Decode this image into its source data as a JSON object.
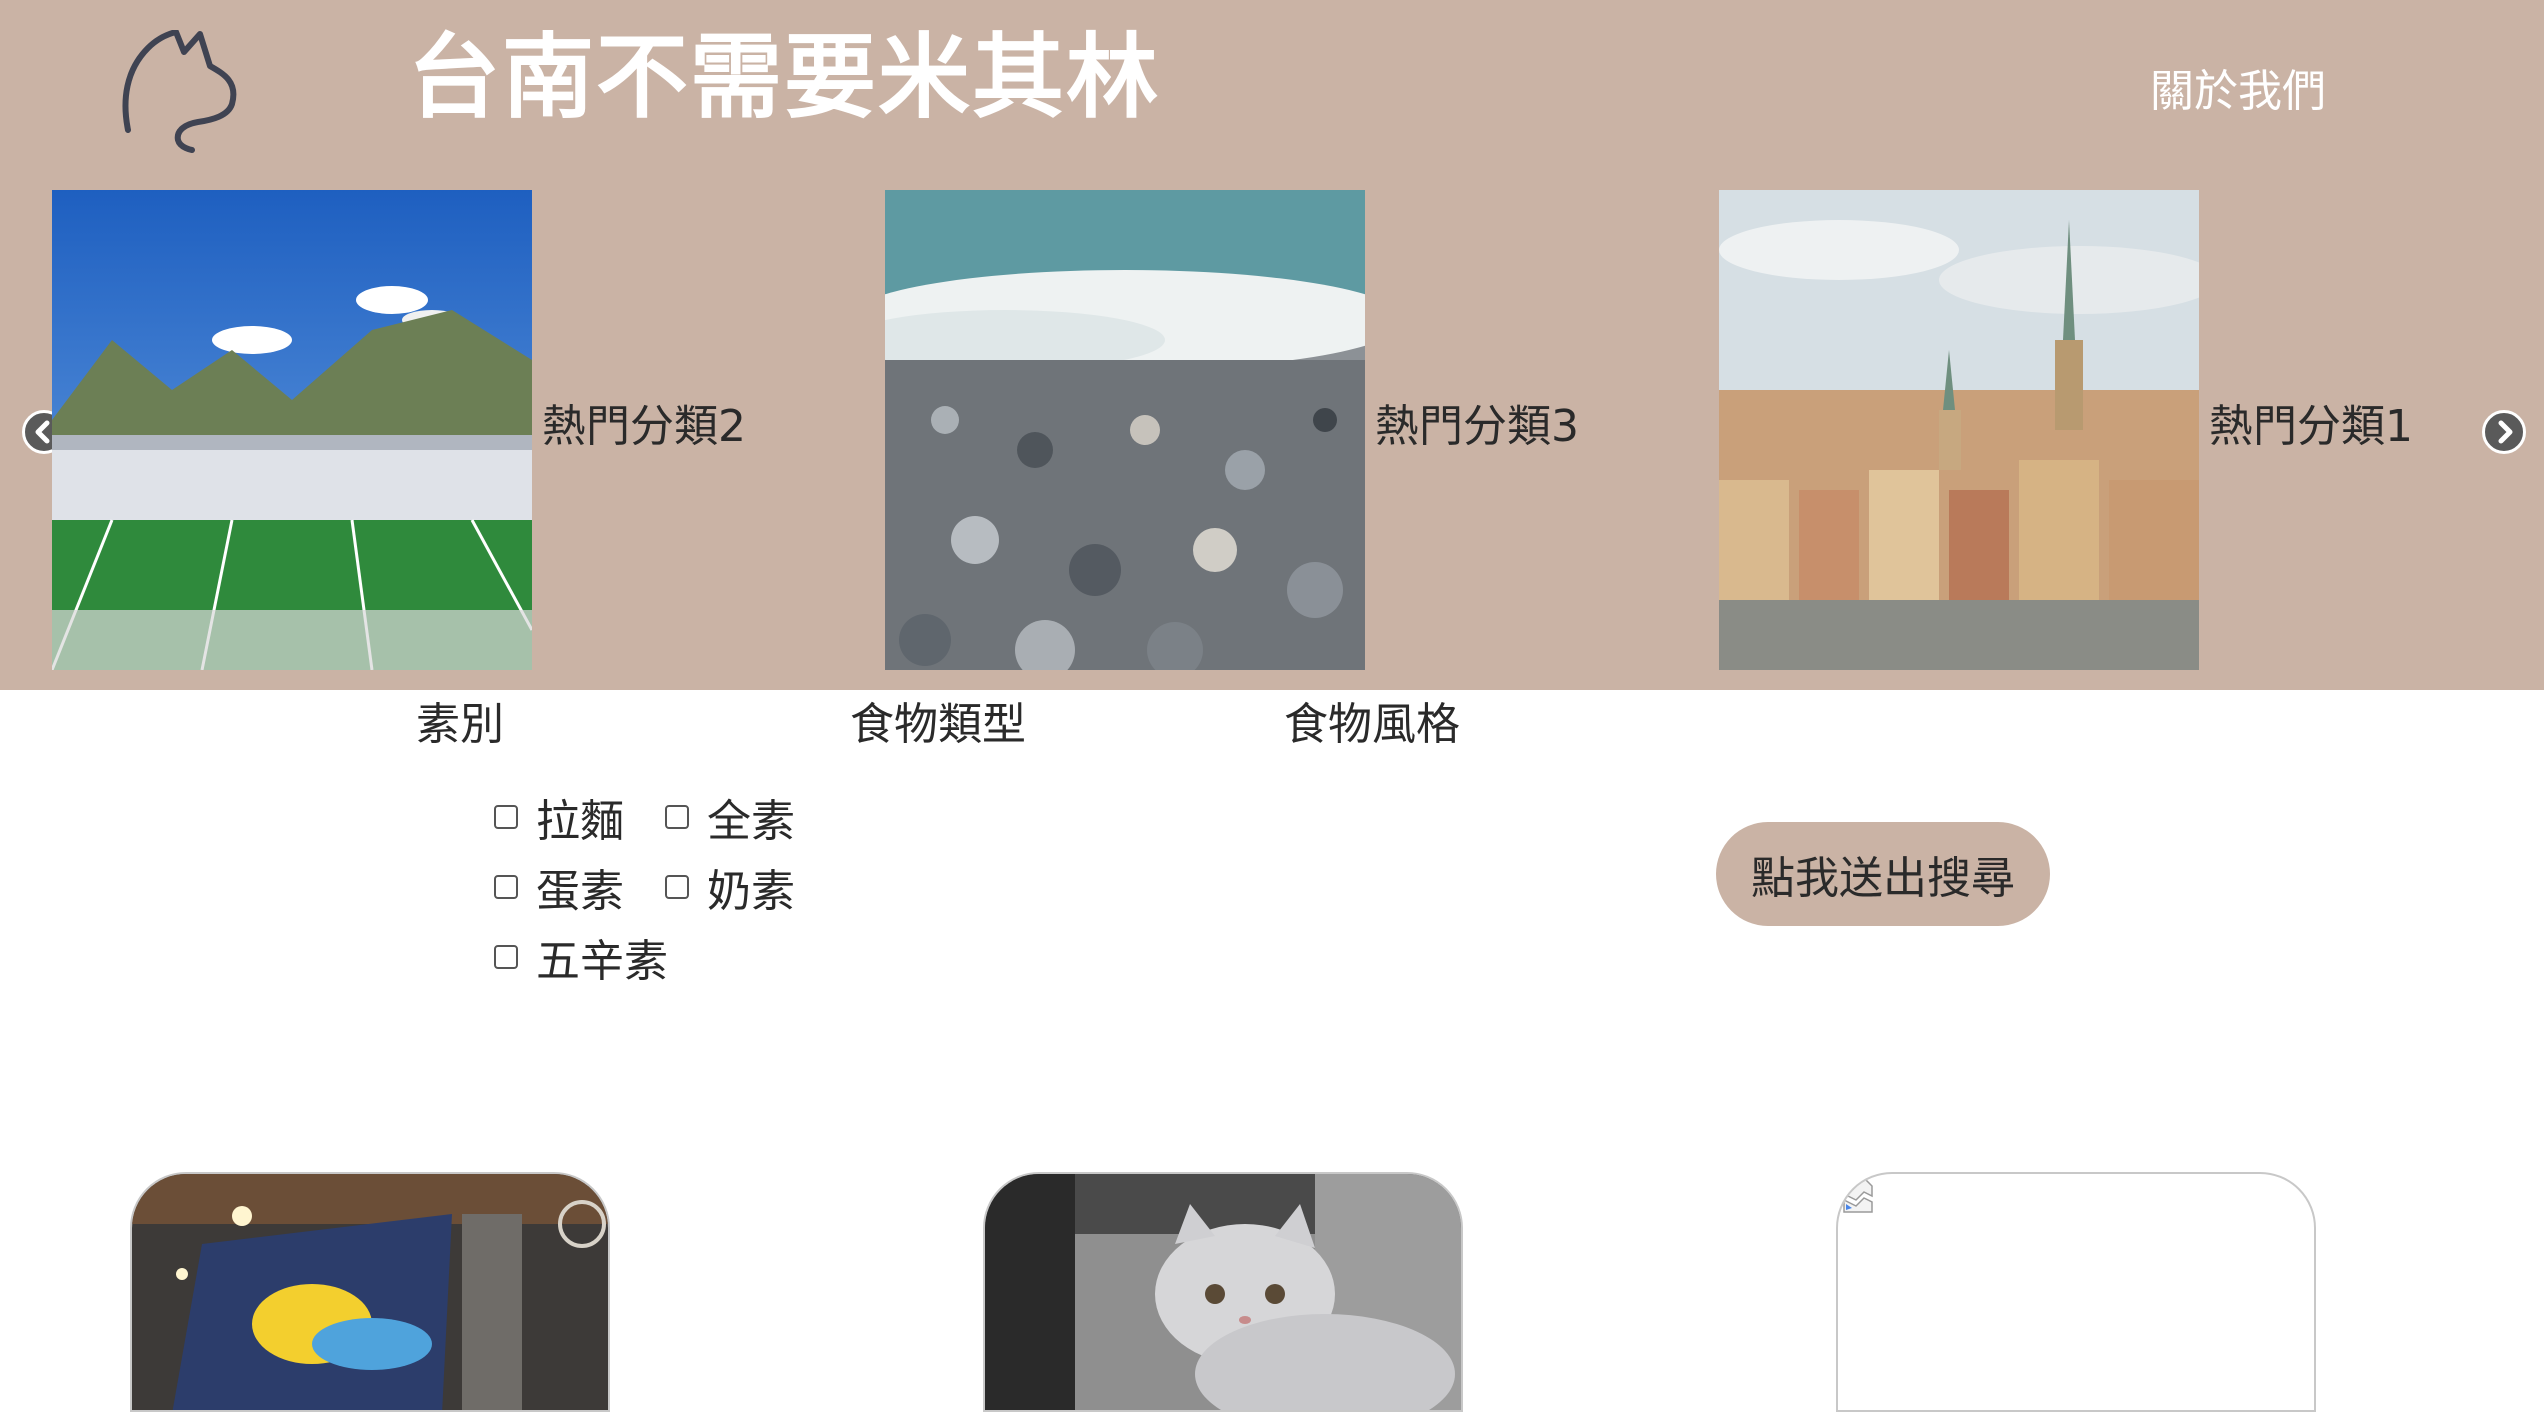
{
  "header": {
    "title": "台南不需要米其林",
    "about_label": "關於我們",
    "logo_icon": "cat-outline-icon",
    "bg_color": "#cab3a5"
  },
  "carousel": {
    "prev_icon": "chevron-left-icon",
    "next_icon": "chevron-right-icon",
    "slides": [
      {
        "label": "熱門分類2",
        "image": "stadium-crowd-photo"
      },
      {
        "label": "熱門分類3",
        "image": "pebble-beach-photo"
      },
      {
        "label": "熱門分類1",
        "image": "european-city-skyline-photo"
      }
    ]
  },
  "filters": {
    "diet_heading": "素別",
    "food_type_heading": "食物類型",
    "food_style_heading": "食物風格",
    "options": [
      {
        "label": "拉麵",
        "checked": false
      },
      {
        "label": "全素",
        "checked": false
      },
      {
        "label": "蛋素",
        "checked": false
      },
      {
        "label": "奶素",
        "checked": false
      },
      {
        "label": "五辛素",
        "checked": false
      }
    ]
  },
  "search": {
    "submit_label": "點我送出搜尋",
    "button_color": "#cab3a5"
  },
  "cards": [
    {
      "image": "ramen-shop-interior-photo"
    },
    {
      "image": "grey-cat-photo"
    },
    {
      "image": "broken-image-icon"
    }
  ]
}
